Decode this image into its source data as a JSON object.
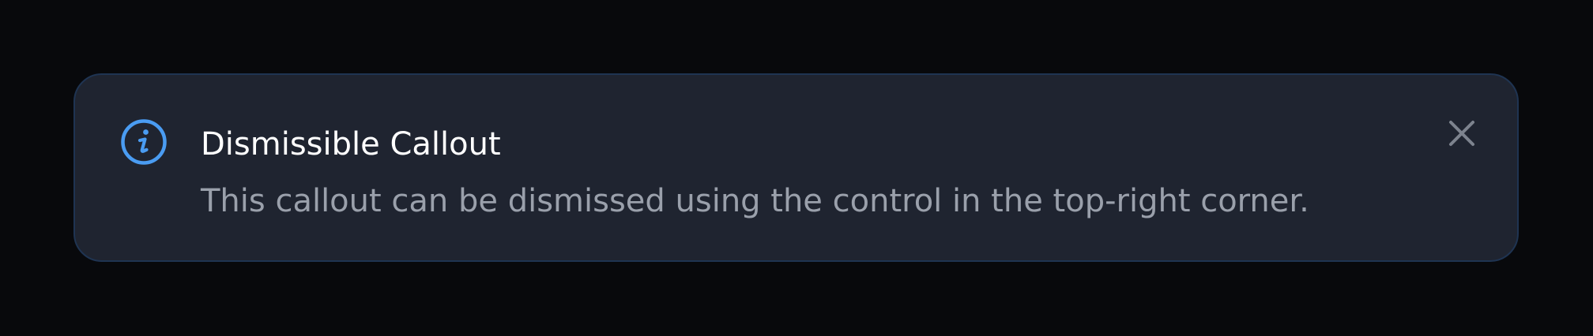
{
  "callout": {
    "icon": "info-icon",
    "title": "Dismissible Callout",
    "message": "This callout can be dismissed using the control in the top-right corner.",
    "close_icon": "close-icon"
  },
  "colors": {
    "page_background": "#08090c",
    "callout_background": "#1f2430",
    "callout_border": "#1f3452",
    "accent": "#4a9cf2",
    "title": "#ffffff",
    "message": "#9aa0ab",
    "close_icon": "#7d838e"
  }
}
